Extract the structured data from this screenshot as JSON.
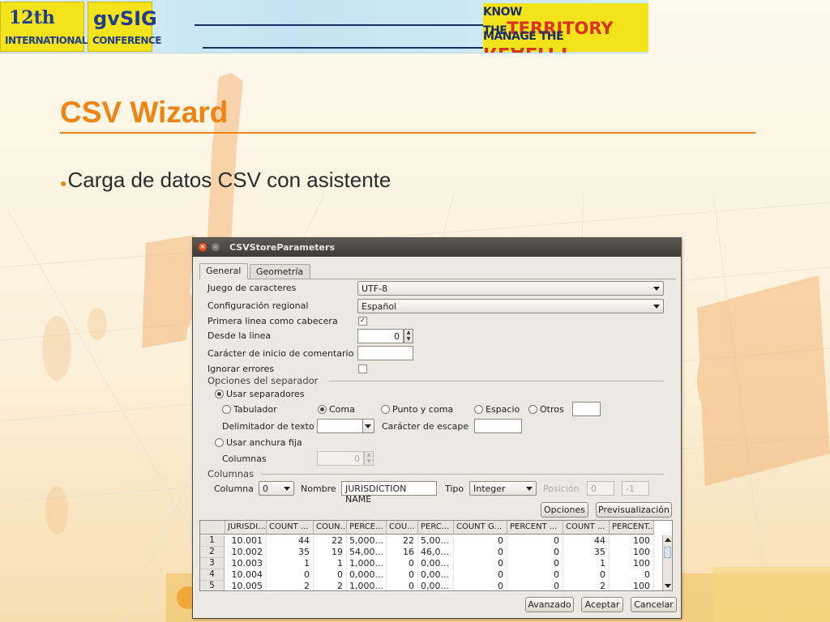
{
  "banner": {
    "left_line1": "12th",
    "left_line2": "INTERNATIONAL",
    "mid_line1": "gvSIG",
    "mid_line2": "CONFERENCE",
    "right_know": "KNOW THE",
    "right_territory": "TERRITORY",
    "right_manage": "MANAGE THE",
    "right_reality": "REALITY"
  },
  "slide": {
    "title": "CSV Wizard",
    "bullet": "Carga de datos CSV con asistente",
    "accent": "#ef8413"
  },
  "window": {
    "title": "CSVStoreParameters",
    "close_glyph": "×",
    "min_glyph": "–",
    "tabs": [
      "General",
      "Geometría"
    ],
    "labels": {
      "charset": "Juego de caracteres",
      "locale": "Configuración regional",
      "header": "Primera linea como cabecera",
      "from_line": "Desde la linea",
      "comment": "Carácter de inicio de comentario",
      "ignore": "Ignorar errores"
    },
    "values": {
      "charset": "UTF-8",
      "locale": "Español",
      "header_checked": "✓",
      "from_line": "0",
      "comment": "",
      "ignore_checked": ""
    },
    "separator": {
      "section": "Opciones del separador",
      "use_separators": "Usar separadores",
      "tab": "Tabulador",
      "comma": "Coma",
      "semicolon": "Punto y coma",
      "space": "Espacio",
      "others": "Otros",
      "others_value": "",
      "text_delim_label": "Delimitador de texto",
      "text_delim_value": "",
      "escape_label": "Carácter de escape",
      "escape_value": "",
      "fixed_width": "Usar anchura fija",
      "columns_label": "Columnas",
      "columns_value": "0",
      "selected": "Coma"
    },
    "columns": {
      "section": "Columnas",
      "column_label": "Columna",
      "column_value": "0",
      "name_label": "Nombre",
      "name_value": "JURISDICTION NAME",
      "type_label": "Tipo",
      "type_value": "Integer",
      "position_label": "Posición",
      "position_value": "0",
      "position_value2": "-1"
    },
    "buttons": {
      "options": "Opciones",
      "preview": "Previsualización",
      "advanced": "Avanzado",
      "accept": "Aceptar",
      "cancel": "Cancelar"
    },
    "table": {
      "headers": [
        "JURISDI...",
        "COUNT ...",
        "COUN...",
        "PERCE...",
        "COU...",
        "PERC...",
        "COUNT G...",
        "PERCENT ...",
        "COUNT ...",
        "PERCENT..."
      ],
      "rows": [
        {
          "n": "1",
          "cells": [
            "10.001",
            "44",
            "22",
            "5,000...",
            "22",
            "5,00...",
            "0",
            "0",
            "44",
            "100"
          ]
        },
        {
          "n": "2",
          "cells": [
            "10.002",
            "35",
            "19",
            "54,00...",
            "16",
            "46,0...",
            "0",
            "0",
            "35",
            "100"
          ]
        },
        {
          "n": "3",
          "cells": [
            "10.003",
            "1",
            "1",
            "1,000...",
            "0",
            "0,00...",
            "0",
            "0",
            "1",
            "100"
          ]
        },
        {
          "n": "4",
          "cells": [
            "10.004",
            "0",
            "0",
            "0,000...",
            "0",
            "0,00...",
            "0",
            "0",
            "0",
            "0"
          ]
        },
        {
          "n": "5",
          "cells": [
            "10.005",
            "2",
            "2",
            "1,000...",
            "0",
            "0,00...",
            "0",
            "0",
            "2",
            "100"
          ]
        }
      ]
    }
  }
}
